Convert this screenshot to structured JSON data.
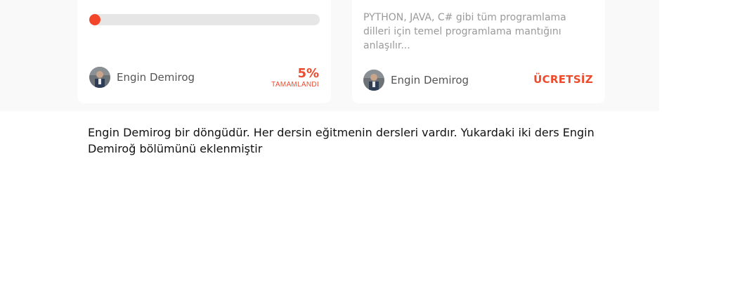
{
  "cards": [
    {
      "progress_pct": 5,
      "author": "Engin Demirog",
      "percent_label": "5%",
      "status_label": "TAMAMLANDI"
    },
    {
      "description": "PYTHON, JAVA, C# gibi tüm programlama dilleri için temel programlama mantığını anlaşılır...",
      "author": "Engin Demirog",
      "price_label": "ÜCRETSİZ"
    }
  ],
  "note": "Engin Demirog bir döngüdür. Her dersin eğitmenin dersleri vardır. Yukardaki iki ders Engin Demiroğ bölümünü eklenmiştir",
  "colors": {
    "accent": "#ee4a2c",
    "track": "#e6e6e6",
    "band": "#f9f9f9"
  }
}
